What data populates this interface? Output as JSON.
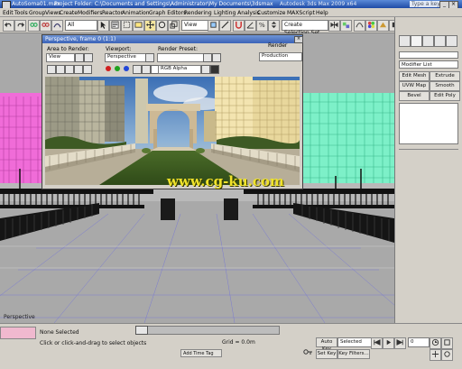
{
  "titlebar": {
    "app_label": "AutoSoma01.max",
    "project_text": "Project Folder: C:\\Documents and Settings\\Administrator\\My Documents\\3dsmax",
    "product_text": "Autodesk 3ds Max  2009  x64",
    "help_text": "Type a keyword"
  },
  "menu": [
    "Edit",
    "Tools",
    "Group",
    "Views",
    "Create",
    "Modifiers",
    "Reactor",
    "Animation",
    "Graph Editors",
    "Rendering",
    "Lighting Analysis",
    "Customize",
    "MAXScript",
    "Help"
  ],
  "toolbar": {
    "selection_filter": "All",
    "reference_coord": "View",
    "named_selection": "Create Selection Set"
  },
  "render_window": {
    "title": "Perspective, frame 0 (1:1)",
    "area_to_render_label": "Area to Render:",
    "area_to_render_value": "View",
    "viewport_label": "Viewport:",
    "viewport_value": "Perspective",
    "render_preset_label": "Render Preset:",
    "render_preset_value": "",
    "render_label": "Render",
    "render_value": "Production",
    "channel_value": "RGB Alpha",
    "swatch_colors": [
      "#d01f1f",
      "#1ea21e",
      "#2246d8"
    ]
  },
  "watermark": "www.cg-ku.com",
  "command_panel": {
    "object_name": "Modifier List",
    "buttons": [
      "Edit Mesh",
      "Extrude",
      "UVW Map",
      "Smooth",
      "Bevel",
      "Edit Poly"
    ]
  },
  "status": {
    "selected_text": "None Selected",
    "prompt_text": "Click or click-and-drag to select objects",
    "grid_label": "Grid = 0.0m",
    "auto_key": "Auto Key",
    "set_key": "Set Key",
    "key_filter": "Selected",
    "key_filters_btn": "Key Filters...",
    "frame": "0",
    "time_tag": "Add Time Tag"
  }
}
